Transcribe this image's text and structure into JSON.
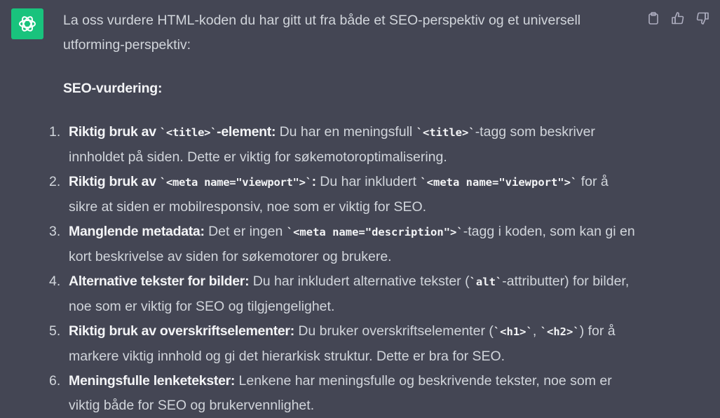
{
  "avatar_icon": "openai-logo-icon",
  "actions": [
    {
      "name": "copy-icon",
      "label": "Copy"
    },
    {
      "name": "thumbs-up-icon",
      "label": "Good response"
    },
    {
      "name": "thumbs-down-icon",
      "label": "Bad response"
    }
  ],
  "intro": "La oss vurdere HTML-koden du har gitt ut fra både et SEO-perspektiv og et universell utforming-perspektiv:",
  "heading": "SEO-vurdering:",
  "items": [
    {
      "num": "1.",
      "t1": "Riktig bruk av ",
      "c1": "`<title>`",
      "t2": "-element:",
      "r1": " Du har en meningsfull ",
      "rc1": "`<title>`",
      "r2": "-tagg som beskriver innholdet på siden. Dette er viktig for søkemotoroptimalisering."
    },
    {
      "num": "2.",
      "t1": "Riktig bruk av ",
      "c1": "`<meta name=\"viewport\">`",
      "t2": ":",
      "r1": " Du har inkludert ",
      "rc1": "`<meta name=\"viewport\">`",
      "r2": " for å sikre at siden er mobilresponsiv, noe som er viktig for SEO."
    },
    {
      "num": "3.",
      "t1": "Manglende metadata:",
      "r1": " Det er ingen ",
      "rc1": "`<meta name=\"description\">`",
      "r2": "-tagg i koden, som kan gi en kort beskrivelse av siden for søkemotorer og brukere."
    },
    {
      "num": "4.",
      "t1": "Alternative tekster for bilder:",
      "r1": " Du har inkludert alternative tekster (",
      "rc1": "`alt`",
      "r2": "-attributter) for bilder, noe som er viktig for SEO og tilgjengelighet."
    },
    {
      "num": "5.",
      "t1": "Riktig bruk av overskriftselementer:",
      "r1": " Du bruker overskriftselementer (",
      "rc1": "`<h1>`",
      "r2": ", ",
      "rc2": "`<h2>`",
      "r3": ") for å markere viktig innhold og gi det hierarkisk struktur. Dette er bra for SEO."
    },
    {
      "num": "6.",
      "t1": "Meningsfulle lenketekster:",
      "r1": " Lenkene har meningsfulle og beskrivende tekster, noe som er viktig både for SEO og brukervennlighet."
    }
  ]
}
